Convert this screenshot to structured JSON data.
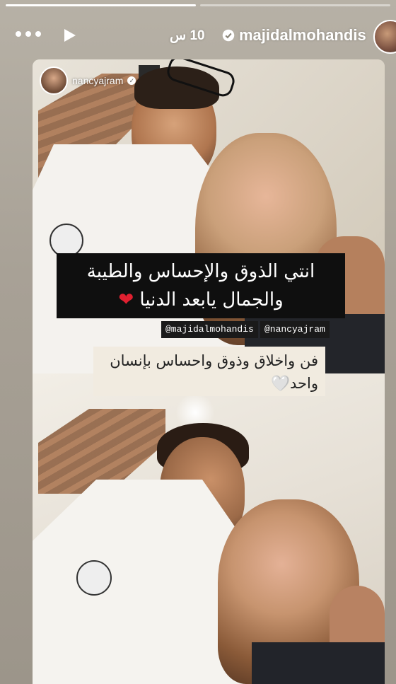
{
  "story": {
    "segments": [
      1.0,
      0.0
    ],
    "time_label": "10 س",
    "username": "majidalmohandis",
    "verified": true
  },
  "card": {
    "tagged_user": "nancyajram",
    "quote": {
      "line1": "انتي الذوق والإحساس والطيبة",
      "line2": "والجمال يابعد الدنيا",
      "heart": "❤"
    },
    "mentions": [
      "@majidalmohandis",
      "@nancyajram"
    ],
    "caption": {
      "line1": "فن واخلاق وذوق واحساس بإنسان",
      "line2": "واحد",
      "heart": "🤍"
    }
  },
  "icons": [
    "more-icon",
    "play-icon",
    "verified-icon"
  ]
}
